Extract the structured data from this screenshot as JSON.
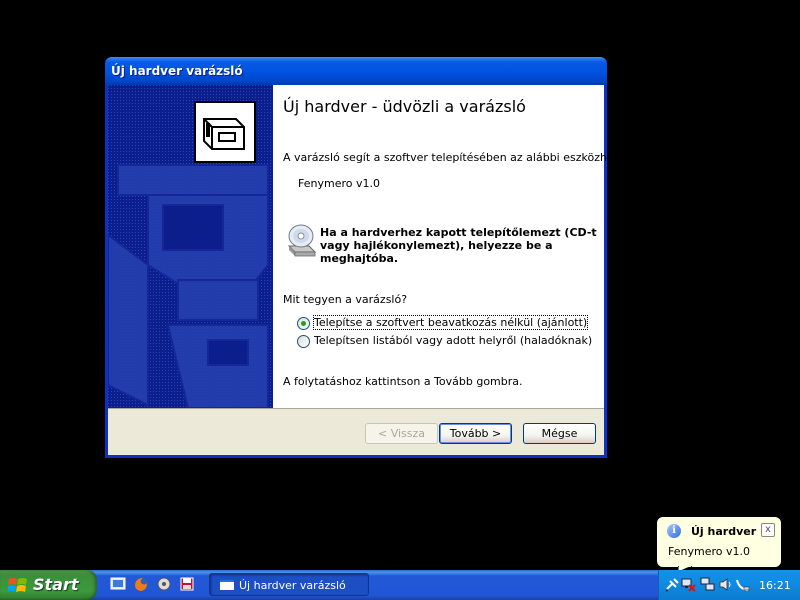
{
  "window": {
    "title": "Új hardver varázsló",
    "heading": "Új hardver - üdvözli a varázsló",
    "intro": "A varázsló segít a szoftver telepítésében az alábbi eszközhöz:",
    "device": "Fenymero v1.0",
    "cd_hint_line1": "Ha a hardverhez kapott telepítőlemezt (CD-t",
    "cd_hint_line2": "vagy hajlékonylemezt), helyezze be a",
    "cd_hint_line3": "meghajtóba.",
    "question": "Mit tegyen a varázsló?",
    "options": [
      {
        "label": "Telepítse a szoftvert beavatkozás nélkül (ajánlott)",
        "selected": true
      },
      {
        "label": "Telepítsen listából vagy adott helyről (haladóknak)",
        "selected": false
      }
    ],
    "continue_hint": "A folytatáshoz kattintson a Tovább gombra.",
    "buttons": {
      "back": "< Vissza",
      "next": "Tovább >",
      "cancel": "Mégse"
    }
  },
  "balloon": {
    "title": "Új hardver",
    "text": "Fenymero v1.0",
    "icon": "info-icon",
    "close": "x"
  },
  "taskbar": {
    "start_label": "Start",
    "task_label": "Új hardver varázsló",
    "clock": "16:21"
  },
  "colors": {
    "title_blue": "#0052e0",
    "banner_blue": "#0b1e8c",
    "dialog_face": "#ece9d8",
    "balloon_bg": "#ffffe1",
    "radio_dot": "#21a121"
  }
}
